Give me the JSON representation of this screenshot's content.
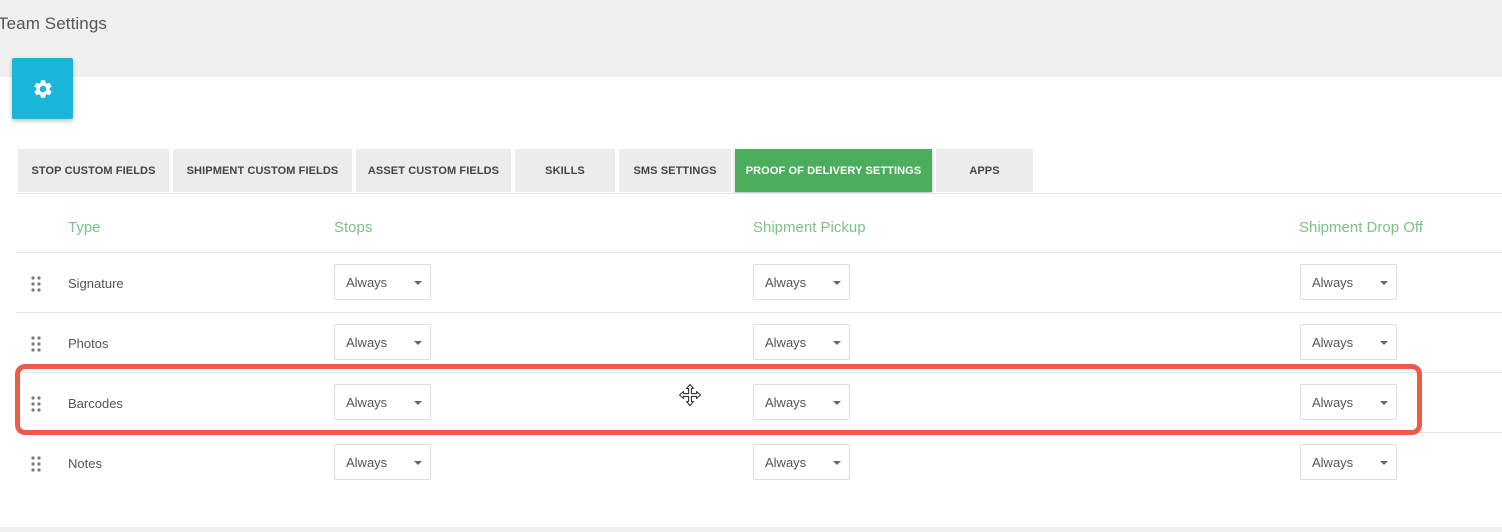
{
  "header": {
    "title": "Team Settings"
  },
  "settings_button": {
    "icon": "gear-icon",
    "color": "#1ab6d8"
  },
  "tabs": [
    {
      "label": "STOP CUSTOM FIELDS",
      "active": false
    },
    {
      "label": "SHIPMENT CUSTOM FIELDS",
      "active": false
    },
    {
      "label": "ASSET CUSTOM FIELDS",
      "active": false
    },
    {
      "label": "SKILLS",
      "active": false
    },
    {
      "label": "SMS SETTINGS",
      "active": false
    },
    {
      "label": "PROOF OF DELIVERY SETTINGS",
      "active": true
    },
    {
      "label": "APPS",
      "active": false
    }
  ],
  "table": {
    "columns": [
      "Type",
      "Stops",
      "Shipment Pickup",
      "Shipment Drop Off"
    ],
    "rows": [
      {
        "type": "Signature",
        "stops": "Always",
        "pickup": "Always",
        "dropoff": "Always"
      },
      {
        "type": "Photos",
        "stops": "Always",
        "pickup": "Always",
        "dropoff": "Always"
      },
      {
        "type": "Barcodes",
        "stops": "Always",
        "pickup": "Always",
        "dropoff": "Always",
        "highlighted": true
      },
      {
        "type": "Notes",
        "stops": "Always",
        "pickup": "Always",
        "dropoff": "Always"
      }
    ]
  },
  "colors": {
    "accent_green": "#4cae5c",
    "header_green": "#7fbf86",
    "highlight_red": "#f15a4a"
  }
}
